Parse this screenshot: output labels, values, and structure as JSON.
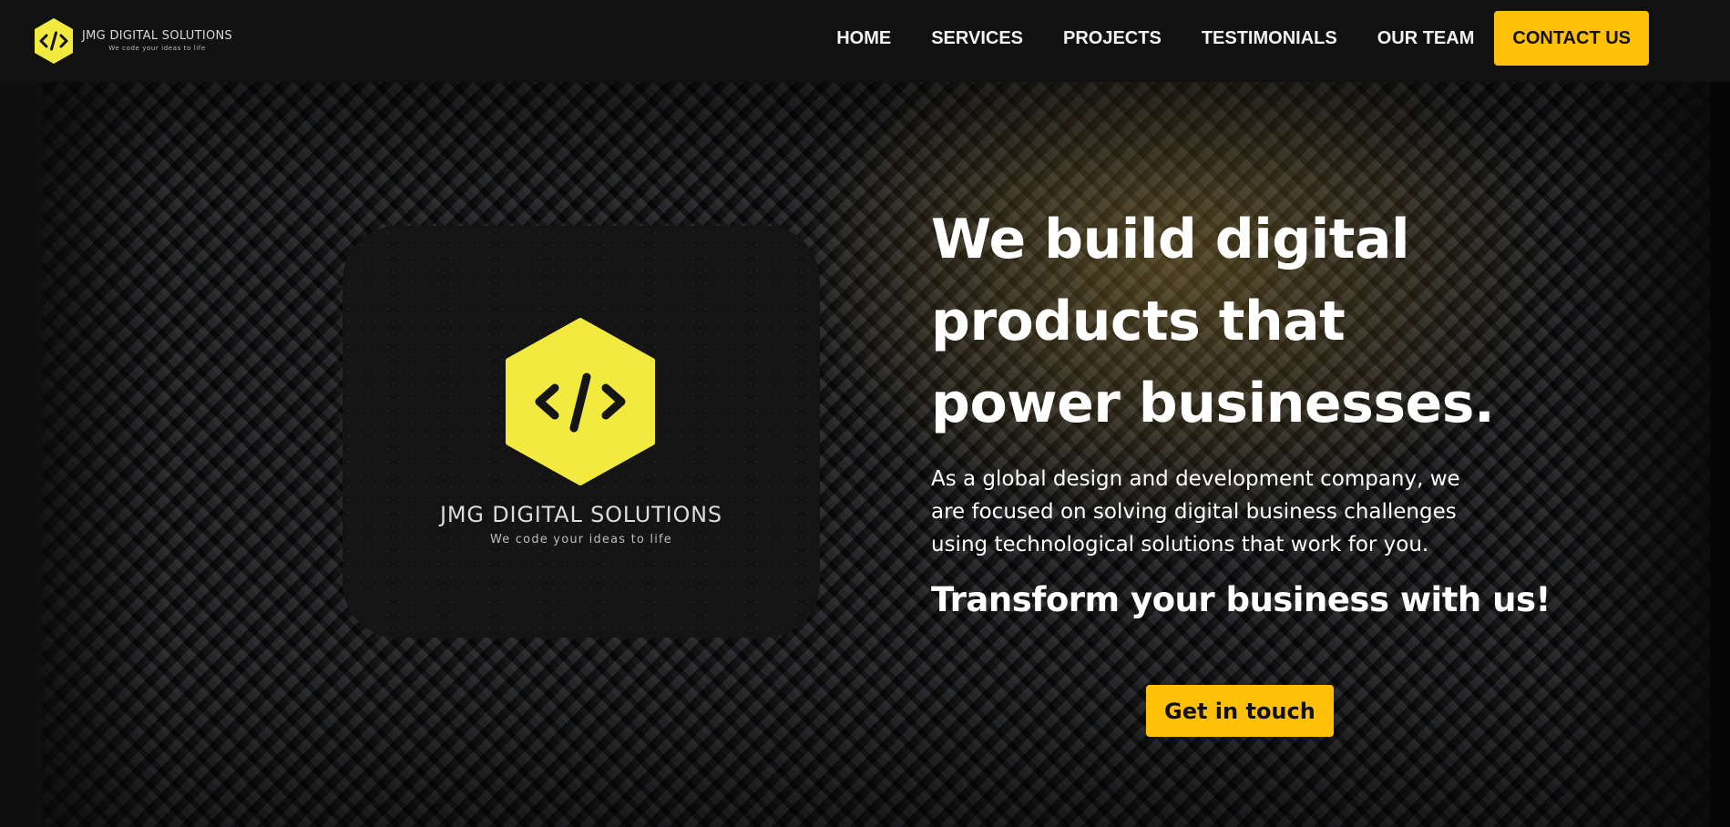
{
  "brand": {
    "name": "JMG DIGITAL SOLUTIONS",
    "tagline": "We code your ideas to life",
    "logo_icon": "code-brackets-hexagon-icon",
    "logo_color": "#f2ea3f"
  },
  "nav": {
    "items": [
      {
        "label": "HOME"
      },
      {
        "label": "SERVICES"
      },
      {
        "label": "PROJECTS"
      },
      {
        "label": "TESTIMONIALS"
      },
      {
        "label": "OUR TEAM"
      }
    ],
    "cta_label": "CONTACT US"
  },
  "hero": {
    "title": "We build digital products that power businesses.",
    "description": "As a global design and development company, we are focused on solving digital business challenges using technological solutions that work for you.",
    "subtitle": "Transform your business with us!",
    "cta_label": "Get in touch",
    "card": {
      "name": "JMG DIGITAL SOLUTIONS",
      "tagline": "We code your ideas to life"
    }
  },
  "colors": {
    "accent": "#ffc107",
    "nav_background": "#121112",
    "logo_yellow": "#f2ea3f",
    "text": "#ffffff"
  }
}
